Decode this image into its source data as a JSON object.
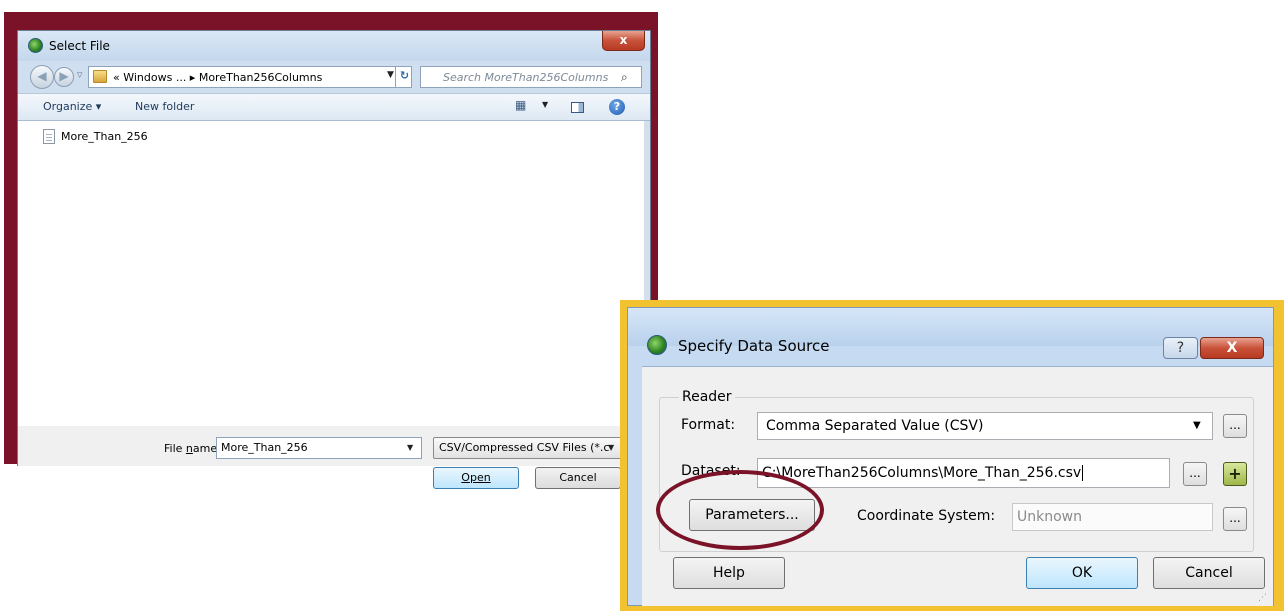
{
  "select_file": {
    "title": "Select File",
    "close_label": "x",
    "nav": {
      "back_label": "◀",
      "forward_label": "▶",
      "history_label": "▽",
      "path": "« Windows ... ▸ MoreThan256Columns",
      "search_placeholder": "Search MoreThan256Columns"
    },
    "toolbar": {
      "organize_label": "Organize ▾",
      "new_folder_label": "New folder"
    },
    "files": [
      {
        "name": "More_Than_256",
        "icon": "document-icon"
      }
    ],
    "file_name_label": "File name:",
    "file_name_value": "More_Than_256",
    "filter_value": "CSV/Compressed CSV Files (*.c",
    "open_label": "Open",
    "cancel_label": "Cancel"
  },
  "specify_data_source": {
    "title": "Specify Data Source",
    "help_label": "?",
    "close_label": "X",
    "group_label": "Reader",
    "format_label": "Format:",
    "format_value": "Comma Separated Value (CSV)",
    "dataset_label": "Dataset:",
    "dataset_value": "C:\\MoreThan256Columns\\More_Than_256.csv",
    "parameters_label": "Parameters...",
    "coordinate_system_label": "Coordinate System:",
    "coordinate_system_value": "Unknown",
    "dots_label": "...",
    "add_label": "+",
    "help_button_label": "Help",
    "ok_label": "OK",
    "cancel_label": "Cancel"
  },
  "colors": {
    "select_file_frame": "#7a1228",
    "specify_data_source_frame": "#f2c231",
    "annotation_ellipse": "#7a1228"
  }
}
